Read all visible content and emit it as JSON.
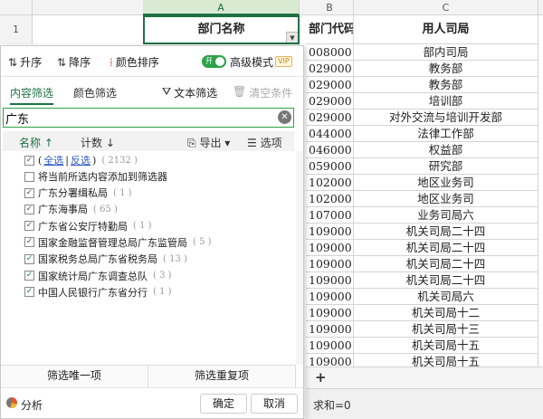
{
  "sheet": {
    "columns": [
      "A",
      "B",
      "C"
    ],
    "row1_num": "1",
    "headers": {
      "a": "部门名称",
      "b": "部门代码",
      "c": "用人司局"
    },
    "rows": [
      {
        "code": "008000",
        "bureau": "部内司局"
      },
      {
        "code": "029000",
        "bureau": "教务部"
      },
      {
        "code": "029000",
        "bureau": "教务部"
      },
      {
        "code": "029000",
        "bureau": "培训部"
      },
      {
        "code": "029000",
        "bureau": "对外交流与培训开发部"
      },
      {
        "code": "044000",
        "bureau": "法律工作部"
      },
      {
        "code": "046000",
        "bureau": "权益部"
      },
      {
        "code": "059000",
        "bureau": "研究部"
      },
      {
        "code": "102000",
        "bureau": "地区业务司"
      },
      {
        "code": "102000",
        "bureau": "地区业务司"
      },
      {
        "code": "107000",
        "bureau": "业务司局六"
      },
      {
        "code": "109000",
        "bureau": "机关司局二十四"
      },
      {
        "code": "109000",
        "bureau": "机关司局二十四"
      },
      {
        "code": "109000",
        "bureau": "机关司局二十四"
      },
      {
        "code": "109000",
        "bureau": "机关司局二十四"
      },
      {
        "code": "109000",
        "bureau": "机关司局六"
      },
      {
        "code": "109000",
        "bureau": "机关司局十二"
      },
      {
        "code": "109000",
        "bureau": "机关司局十三"
      },
      {
        "code": "109000",
        "bureau": "机关司局十五"
      },
      {
        "code": "109000",
        "bureau": "机关司局十五"
      }
    ],
    "add_sheet": "+",
    "status_sum": "求和=0"
  },
  "panel": {
    "toolbar": {
      "asc": "升序",
      "desc": "降序",
      "color_sort": "颜色排序",
      "toggle": "开",
      "advanced": "高级模式",
      "vip": "VIP"
    },
    "tabs": {
      "content": "内容筛选",
      "color": "颜色筛选"
    },
    "text_filter": "文本筛选",
    "clear_conditions": "清空条件",
    "search_value": "广东",
    "list_header": {
      "name": "名称",
      "count": "计数",
      "export": "导出",
      "options": "选项"
    },
    "select_all": "全选",
    "invert": "反选",
    "total_count": "( 2132 )",
    "add_to_filter": "将当前所选内容添加到筛选器",
    "items": [
      {
        "label": "广东分署缉私局",
        "count": "( 1 )"
      },
      {
        "label": "广东海事局",
        "count": "( 65 )"
      },
      {
        "label": "广东省公安厅特勤局",
        "count": "( 1 )"
      },
      {
        "label": "国家金融监督管理总局广东监管局",
        "count": "( 5 )"
      },
      {
        "label": "国家税务总局广东省税务局",
        "count": "( 13 )"
      },
      {
        "label": "国家统计局广东调查总队",
        "count": "( 3 )"
      },
      {
        "label": "中国人民银行广东省分行",
        "count": "( 1 )"
      }
    ],
    "unique_btn": "筛选唯一项",
    "dup_btn": "筛选重复项",
    "analysis": "分析",
    "ok": "确定",
    "cancel": "取消"
  }
}
